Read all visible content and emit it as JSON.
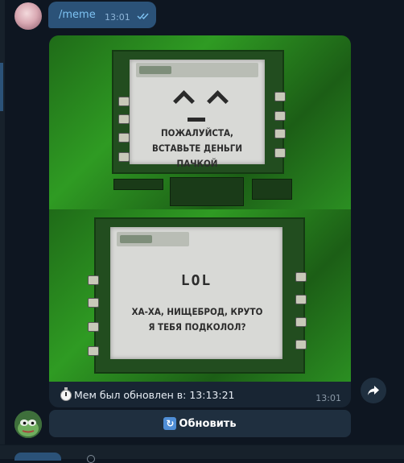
{
  "outgoing": {
    "command": "/meme",
    "time": "13:01"
  },
  "meme": {
    "top_panel_text": "ПОЖАЛУЙСТА, ВСТАВЬТЕ ДЕНЬГИ ПАЧКОЙ",
    "bottom_panel_title": "LOL",
    "bottom_panel_text": "ХА-ХА, НИЩЕБРОД, КРУТО Я ТЕБЯ ПОДКОЛОЛ?",
    "caption": "Мем был обновлен в: 13:13:21",
    "time": "13:01"
  },
  "inline_button": {
    "label": "Обновить"
  },
  "icons": {
    "read_status": "double-check-icon",
    "caption_icon": "stopwatch-icon",
    "share": "share-icon",
    "refresh": "refresh-icon"
  },
  "colors": {
    "background": "#0e1621",
    "outgoing_bubble": "#2b5278",
    "incoming_bubble": "#182533",
    "button": "#1f2f3f",
    "accent": "#7ec3f3"
  }
}
